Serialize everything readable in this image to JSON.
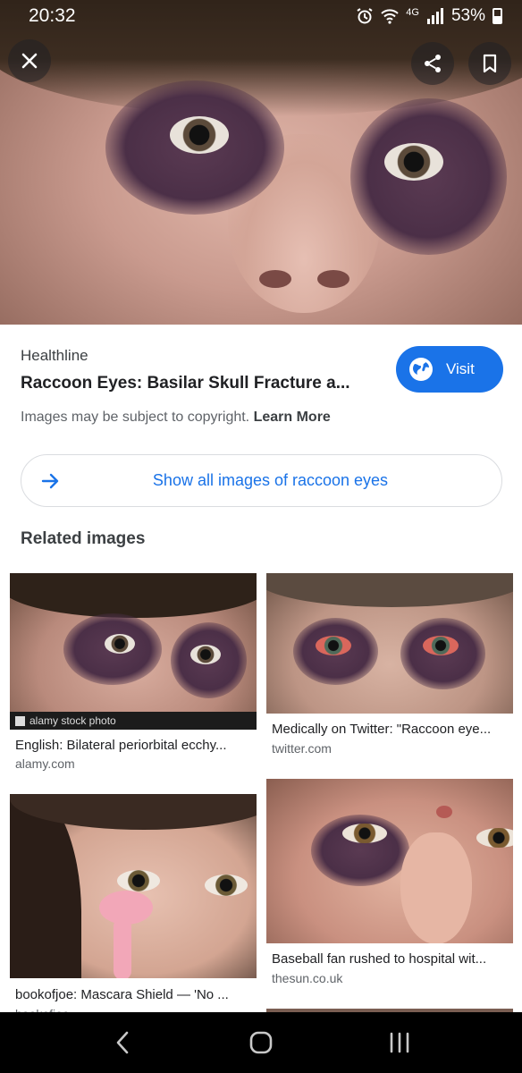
{
  "status_bar": {
    "time": "20:32",
    "network": "4G",
    "battery": "53%"
  },
  "hero": {
    "icons": {
      "close": "close-icon",
      "share": "share-icon",
      "bookmark": "bookmark-icon"
    }
  },
  "result": {
    "source": "Healthline",
    "title": "Raccoon Eyes: Basilar Skull Fracture a...",
    "visit_label": "Visit",
    "copyright_text": "Images may be subject to copyright.",
    "learn_more": "Learn More",
    "show_all_label": "Show all images of raccoon eyes"
  },
  "related": {
    "heading": "Related images",
    "items": [
      {
        "title": "English: Bilateral periorbital ecchy...",
        "domain": "alamy.com",
        "watermark": "alamy stock photo"
      },
      {
        "title": "Medically on Twitter: \"Raccoon eye...",
        "domain": "twitter.com"
      },
      {
        "title": "bookofjoe: Mascara Shield — 'No ...",
        "domain": "bookofjoe"
      },
      {
        "title": "Baseball fan rushed to hospital wit...",
        "domain": "thesun.co.uk"
      }
    ]
  },
  "colors": {
    "accent": "#1a73e8",
    "text_primary": "#202124",
    "text_secondary": "#5f6368"
  }
}
